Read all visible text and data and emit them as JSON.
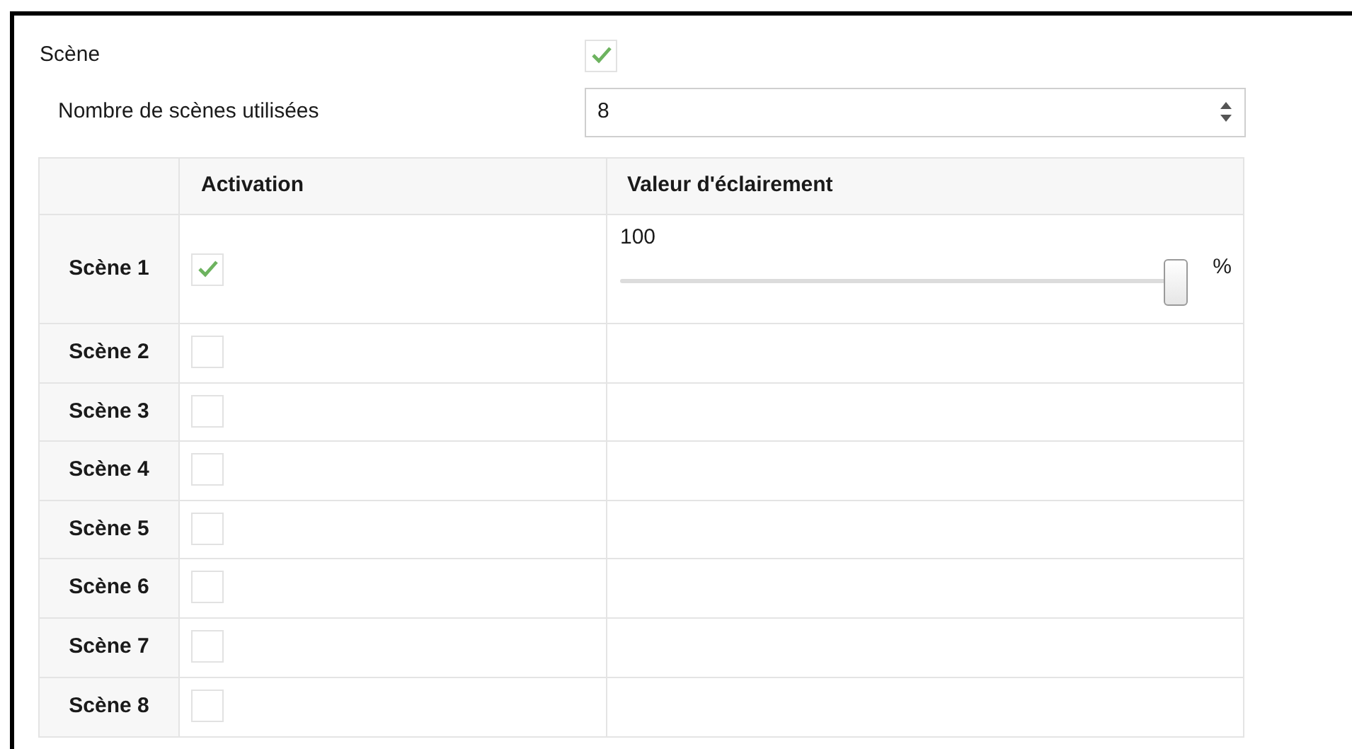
{
  "scene": {
    "label": "Scène",
    "checked": true
  },
  "count": {
    "label": "Nombre de scènes utilisées",
    "value": "8"
  },
  "table": {
    "columns": [
      "Activation",
      "Valeur d'éclairement"
    ],
    "rows": [
      {
        "label": "Scène 1",
        "checked": true,
        "slider": {
          "reading": "100",
          "level": 1,
          "unit": "%"
        }
      },
      {
        "label": "Scène 2",
        "checked": false
      },
      {
        "label": "Scène 3",
        "checked": false
      },
      {
        "label": "Scène 4",
        "checked": false
      },
      {
        "label": "Scène 5",
        "checked": false
      },
      {
        "label": "Scène 6",
        "checked": false
      },
      {
        "label": "Scène 7",
        "checked": false
      },
      {
        "label": "Scène 8",
        "checked": false
      }
    ]
  }
}
